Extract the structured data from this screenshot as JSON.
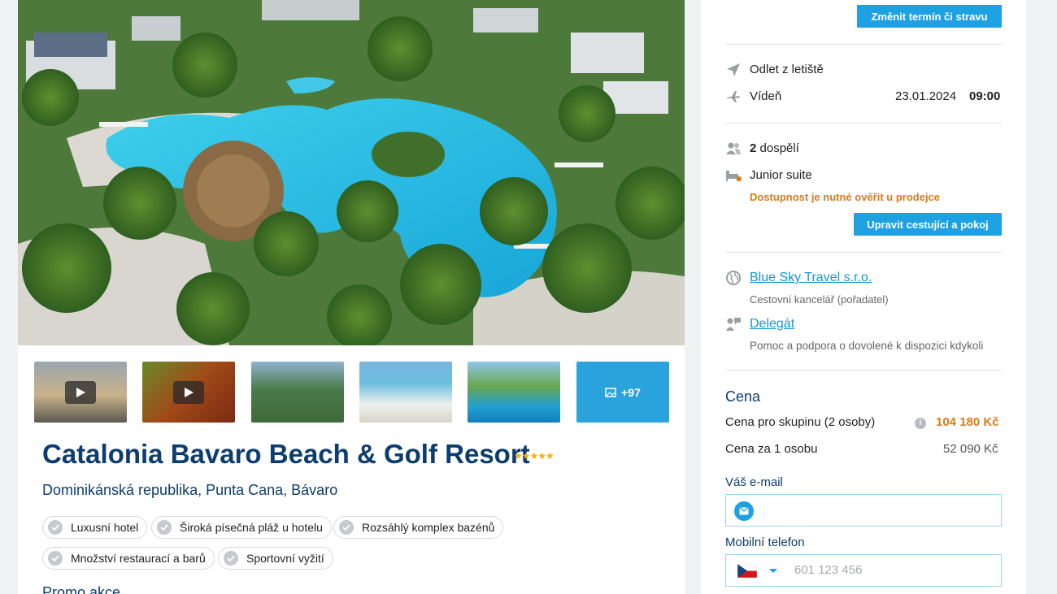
{
  "gallery": {
    "more_count": "+97",
    "thumbnails": [
      {
        "type": "video"
      },
      {
        "type": "video"
      },
      {
        "type": "image"
      },
      {
        "type": "image"
      },
      {
        "type": "image"
      },
      {
        "type": "more"
      }
    ]
  },
  "hotel": {
    "name": "Catalonia Bavaro Beach & Golf Resort",
    "stars": "★★★★★",
    "star_count": 5,
    "location": "Dominikánská republika, Punta Cana, Bávaro",
    "tags": [
      "Luxusní hotel",
      "Široká písečná pláž u hotelu",
      "Rozsáhlý komplex bazénů",
      "Množství restaurací a barů",
      "Sportovní vyžití"
    ],
    "promo_heading": "Promo akce"
  },
  "booking": {
    "change_date_button": "Změnit termín či stravu",
    "departure": {
      "heading": "Odlet z letiště",
      "airport": "Vídeň",
      "date": "23.01.2024",
      "time": "09:00"
    },
    "travellers": {
      "count": "2",
      "label": "dospělí",
      "room": "Junior suite",
      "availability_warning": "Dostupnost je nutné ověřit u prodejce",
      "edit_button": "Upravit cestující a pokoj"
    },
    "organizer": {
      "name": "Blue Sky Travel s.r.o.",
      "role": "Cestovní kancelář (pořadatel)"
    },
    "delegate": {
      "name": "Delegát",
      "description": "Pomoc a podpora o dovolené k dispozici kdykoli"
    },
    "price": {
      "heading": "Cena",
      "group_label": "Cena pro skupinu (2 osoby)",
      "group_value": "104 180 Kč",
      "person_label": "Cena za 1 osobu",
      "person_value": "52 090 Kč"
    },
    "contact": {
      "email_label": "Váš e-mail",
      "email_value": "",
      "phone_label": "Mobilní telefon",
      "phone_placeholder": "601 123 456"
    }
  },
  "colors": {
    "accent": "#1da1e3",
    "heading": "#0d3d6e",
    "warning": "#e07a16",
    "price_highlight": "#e07a16"
  }
}
